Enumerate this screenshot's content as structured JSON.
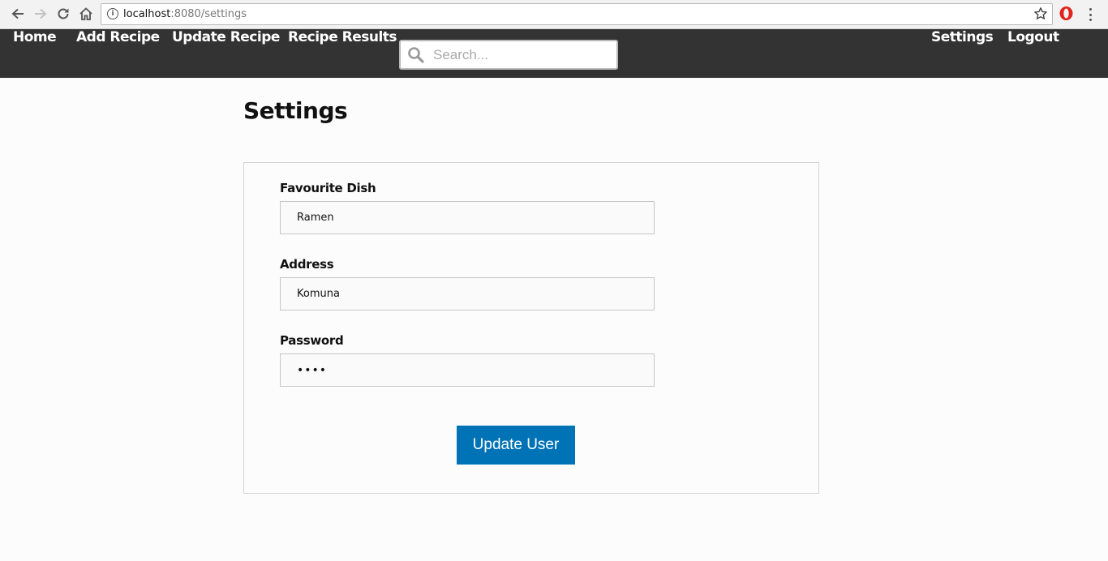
{
  "browser": {
    "url_host": "localhost",
    "url_path": ":8080/settings"
  },
  "nav": {
    "home": "Home",
    "add_recipe": "Add Recipe",
    "update_recipe": "Update Recipe",
    "recipe_results": "Recipe Results",
    "search_placeholder": "Search...",
    "settings": "Settings",
    "logout": "Logout"
  },
  "page": {
    "title": "Settings"
  },
  "form": {
    "favourite_dish_label": "Favourite Dish",
    "favourite_dish_value": "Ramen",
    "address_label": "Address",
    "address_value": "Komuna",
    "password_label": "Password",
    "password_value": "••••",
    "submit_label": "Update User"
  },
  "colors": {
    "nav_bg": "#333333",
    "button_bg": "#0073b7"
  },
  "icons": {
    "back": "arrow-left-icon",
    "forward": "arrow-right-icon",
    "reload": "reload-icon",
    "home": "home-icon",
    "info": "info-icon",
    "bookmark": "star-icon",
    "opera": "opera-icon",
    "menu": "kebab-menu-icon",
    "search": "search-icon"
  }
}
